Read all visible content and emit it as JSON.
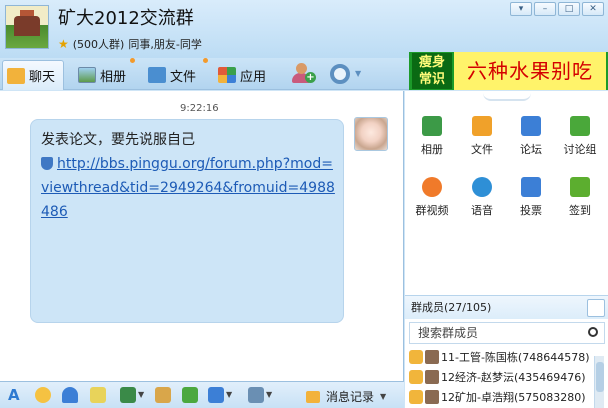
{
  "header": {
    "title": "矿大2012交流群",
    "member_count_text": "(500人群)",
    "tags": "同事,朋友-同学"
  },
  "toolbar": {
    "tabs": [
      {
        "label": "聊天"
      },
      {
        "label": "相册"
      },
      {
        "label": "文件"
      },
      {
        "label": "应用"
      }
    ]
  },
  "ad": {
    "tag_line1": "瘦身",
    "tag_line2": "常识",
    "text": "六种水果别吃"
  },
  "chat": {
    "timestamp": "9:22:16",
    "message_text": "发表论文，要先说服自己",
    "message_link": "http://bbs.pinggu.org/forum.php?mod=viewthread&tid=2949264&fromuid=4988486"
  },
  "apps": [
    {
      "label": "相册",
      "icon": "photo-icon",
      "color": "#3c9a47"
    },
    {
      "label": "文件",
      "icon": "folder-icon",
      "color": "#f0a12a"
    },
    {
      "label": "论坛",
      "icon": "forum-icon",
      "color": "#3c7fd6"
    },
    {
      "label": "讨论组",
      "icon": "discussion-icon",
      "color": "#4aa83a"
    },
    {
      "label": "群视频",
      "icon": "video-icon",
      "color": "#f07a2a"
    },
    {
      "label": "语音",
      "icon": "voice-icon",
      "color": "#2e8fd6"
    },
    {
      "label": "投票",
      "icon": "vote-icon",
      "color": "#3c7fd6"
    },
    {
      "label": "签到",
      "icon": "checkin-icon",
      "color": "#5cae2f"
    }
  ],
  "members": {
    "header": "群成员(27/105)",
    "search_placeholder": "搜索群成员",
    "list": [
      {
        "name": "11-工管-陈国栋(748644578)"
      },
      {
        "name": "12经济-赵梦沄(435469476)"
      },
      {
        "name": "12矿加-卓浩翔(575083280)"
      }
    ]
  },
  "bottom": {
    "history_label": "消息记录"
  },
  "colors": {
    "accent": "#1d5bb6",
    "bubble": "#cde5f7",
    "ad_bg": "#fff36a",
    "ad_text": "#d40000"
  }
}
